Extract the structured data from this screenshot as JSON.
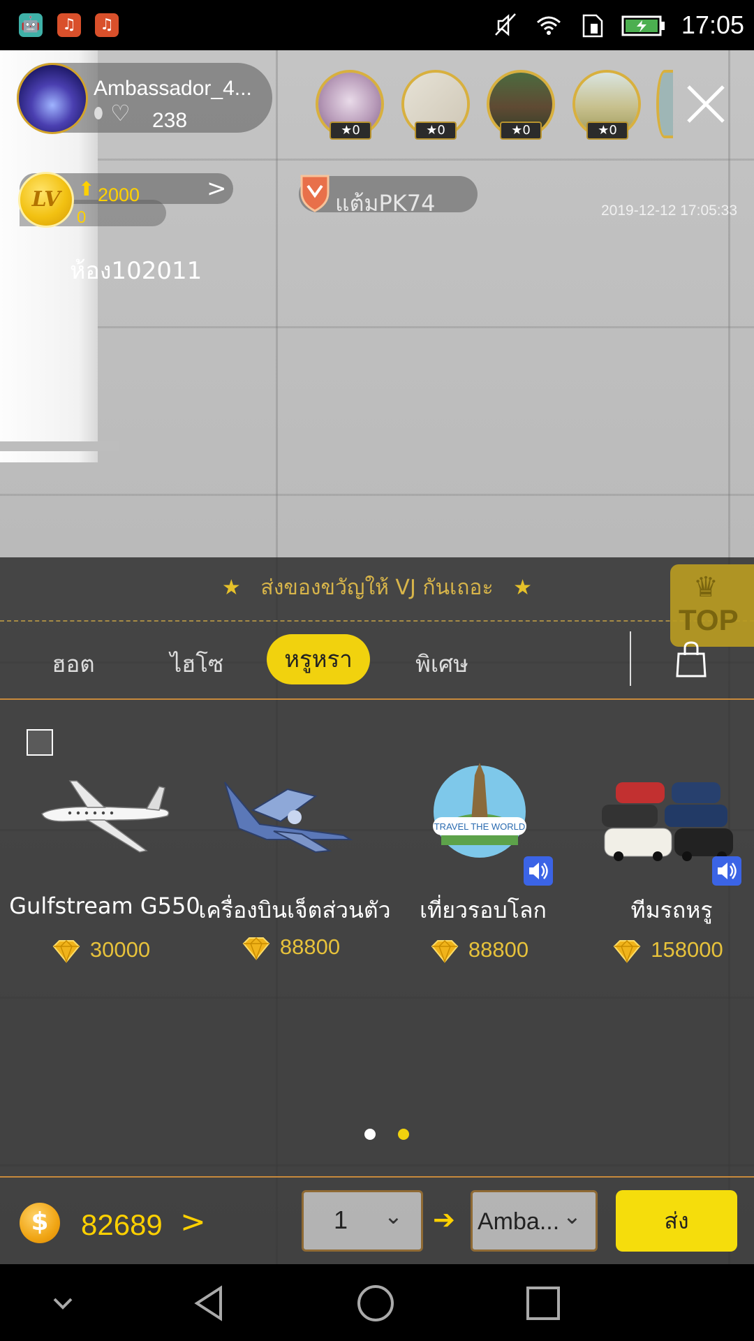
{
  "status_bar": {
    "time": "17:05",
    "notification_icons": [
      "android-icon",
      "music-icon",
      "music-icon"
    ],
    "system_icons": [
      "mute-icon",
      "wifi-icon",
      "sim-icon",
      "battery-charging-icon"
    ]
  },
  "host": {
    "name": "Ambassador_4...",
    "likes": "238"
  },
  "viewers": [
    {
      "count": "0"
    },
    {
      "count": "0"
    },
    {
      "count": "0"
    },
    {
      "count": "0"
    }
  ],
  "level": {
    "badge": "LV",
    "target": "2000",
    "current": "0"
  },
  "pk": {
    "label": "แต้มPK74"
  },
  "timestamp": "2019-12-12 17:05:33",
  "room": {
    "id": "ห้อง102011"
  },
  "gift_panel": {
    "header": "ส่งของขวัญให้ VJ กันเถอะ",
    "top_label": "TOP",
    "tabs": [
      {
        "label": "ฮอต",
        "active": false
      },
      {
        "label": "ไฮโซ",
        "active": false
      },
      {
        "label": "หรูหรา",
        "active": true
      },
      {
        "label": "พิเศษ",
        "active": false
      }
    ],
    "gifts": [
      {
        "name": "Gulfstream G550",
        "price": "30000",
        "sound": false
      },
      {
        "name": "เครื่องบินเจ็ตส่วนตัว",
        "price": "88800",
        "sound": false
      },
      {
        "name": "เที่ยวรอบโลก",
        "price": "88800",
        "sound": true,
        "image_text": "TRAVEL THE WORLD"
      },
      {
        "name": "ทีมรถหรู",
        "price": "158000",
        "sound": true
      }
    ],
    "page_dots": {
      "count": 2,
      "active": 2
    }
  },
  "bottom_bar": {
    "balance": "82689",
    "quantity": "1",
    "recipient": "Amba...",
    "send_label": "ส่ง"
  },
  "colors": {
    "accent_yellow": "#f1d20e",
    "gold": "#e7c23b",
    "divider_orange": "#c88a3c"
  }
}
